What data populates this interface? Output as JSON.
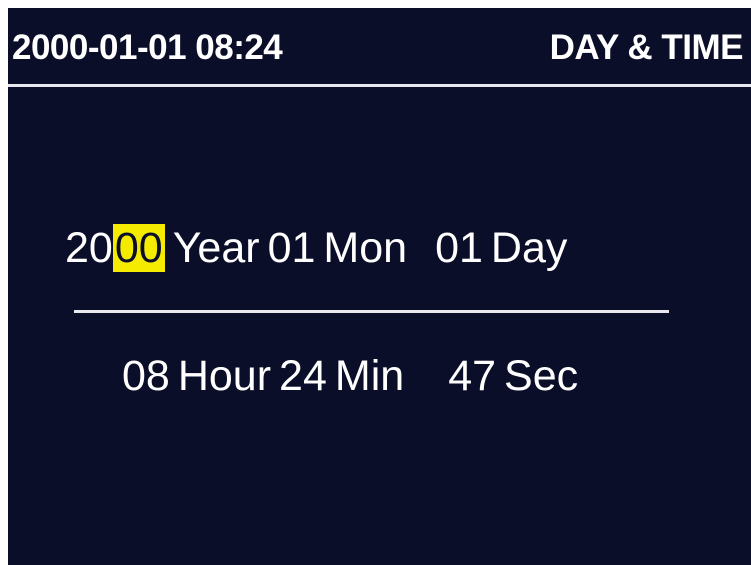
{
  "header": {
    "datetime": "2000-01-01 08:24",
    "title": "DAY & TIME"
  },
  "date": {
    "year_prefix": "20",
    "year_suffix": "00",
    "year_label": "Year",
    "month_value": "01",
    "month_label": "Mon",
    "day_value": "01",
    "day_label": "Day"
  },
  "time": {
    "hour_value": "08",
    "hour_label": "Hour",
    "minute_value": "24",
    "minute_label": "Min",
    "second_value": "47",
    "second_label": "Sec"
  },
  "colors": {
    "background": "#0b0e29",
    "text": "#ffffff",
    "cursor_highlight": "#f5eb00"
  }
}
